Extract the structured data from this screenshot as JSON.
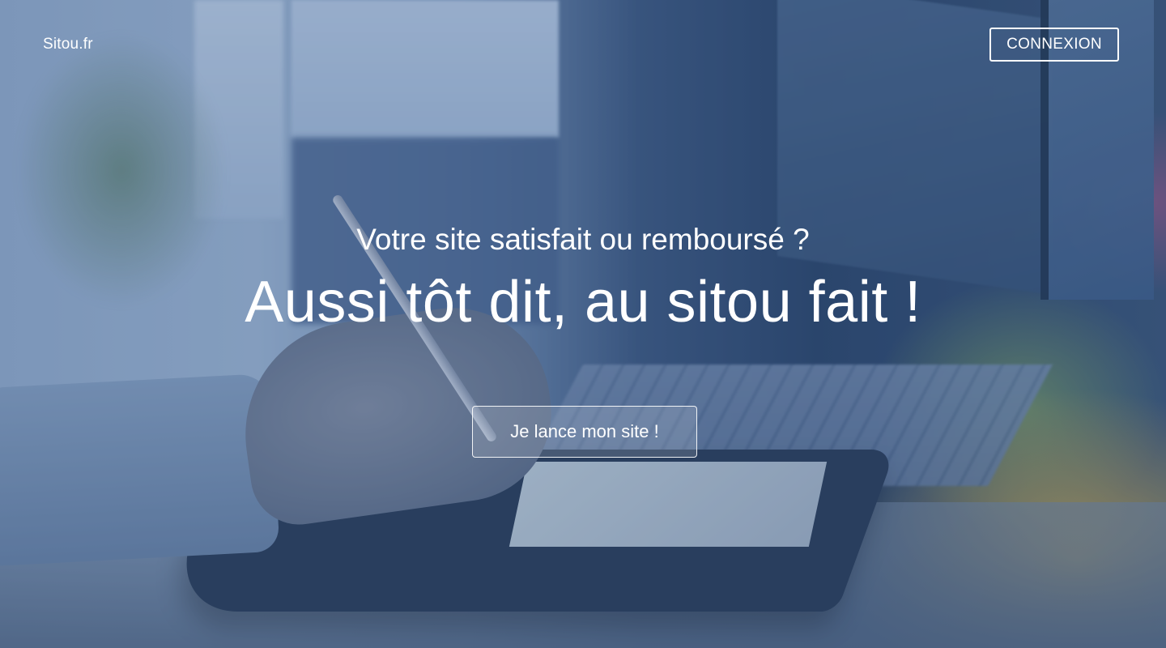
{
  "header": {
    "brand": "Sitou.fr",
    "login_button": "CONNEXION"
  },
  "hero": {
    "subtitle": "Votre site satisfait ou remboursé ?",
    "headline_before": "Aussi tôt dit, au ",
    "headline_emphasis": "sitou",
    "headline_after": " fait !",
    "cta_button": "Je lance mon site !"
  },
  "background": {
    "description_icon": "photo-background",
    "overlay_color": "#26467a"
  }
}
